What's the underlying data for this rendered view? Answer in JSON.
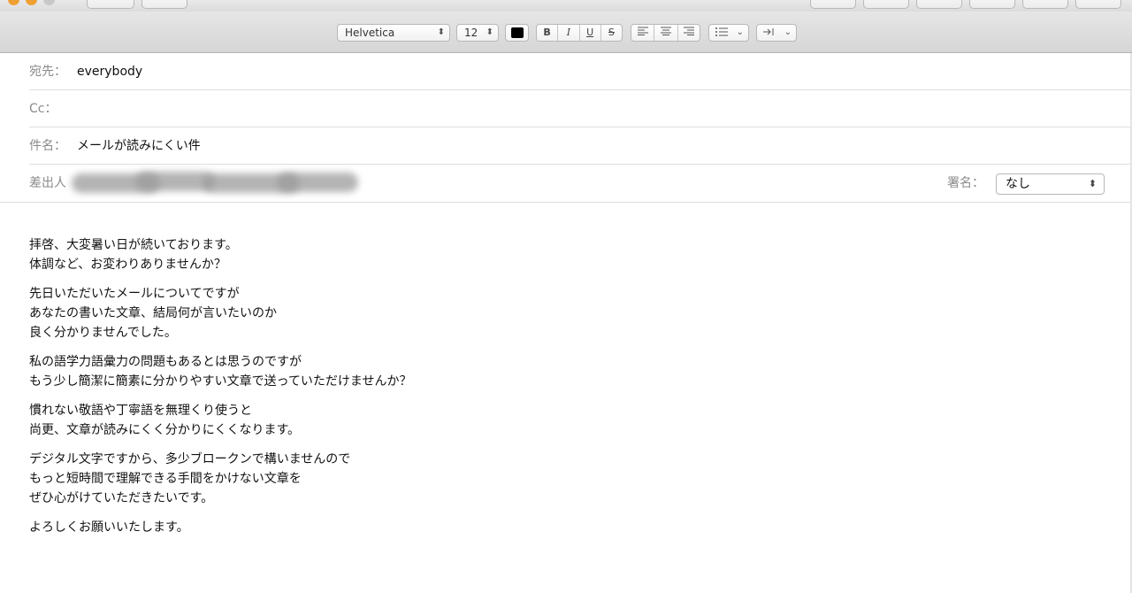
{
  "format_bar": {
    "font_family": "Helvetica",
    "font_size": "12",
    "bold": "B",
    "italic": "I",
    "underline": "U",
    "strike": "S",
    "list_icon": "list-icon",
    "indent_icon": "indent-icon"
  },
  "header": {
    "to_label": "宛先：",
    "to_value": "everybody",
    "cc_label": "Cc：",
    "subject_label": "件名：",
    "subject_value": "メールが読みにくい件",
    "from_label": "差出人",
    "signature_label": "署名：",
    "signature_value": "なし"
  },
  "body": {
    "paragraphs": [
      [
        "拝啓、大変暑い日が続いております。",
        "体調など、お変わりありませんか？"
      ],
      [
        "先日いただいたメールについてですが",
        "あなたの書いた文章、結局何が言いたいのか",
        "良く分かりませんでした。"
      ],
      [
        "私の語学力語彙力の問題もあるとは思うのですが",
        "もう少し簡潔に簡素に分かりやすい文章で送っていただけませんか？"
      ],
      [
        "慣れない敬語や丁寧語を無理くり使うと",
        "尚更、文章が読みにくく分かりにくくなります。"
      ],
      [
        "デジタル文字ですから、多少ブロークンで構いませんので",
        "もっと短時間で理解できる手間をかけない文章を",
        "ぜひ心がけていただきたいです。"
      ],
      [
        "よろしくお願いいたします。"
      ]
    ]
  },
  "colors": {
    "accent_window": "#f0a033",
    "label_gray": "#8a8a8a"
  }
}
